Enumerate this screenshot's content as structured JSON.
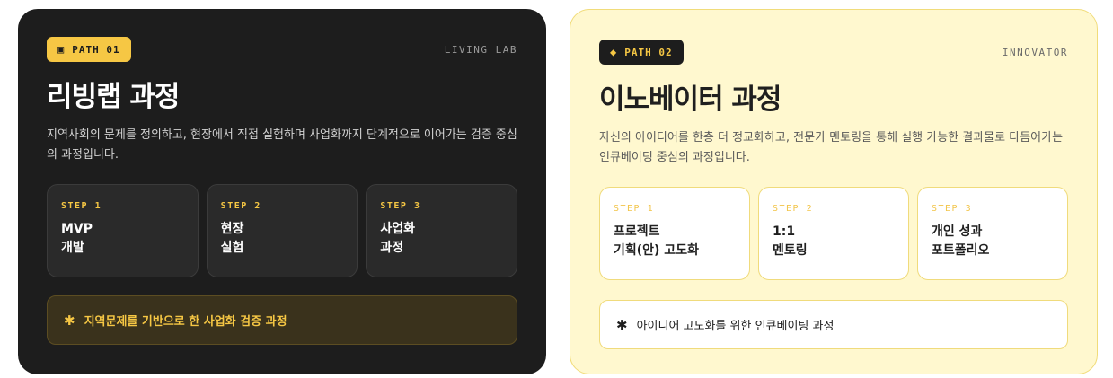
{
  "cards": [
    {
      "badge": {
        "icon": "box-icon",
        "glyph": "▣",
        "label": "PATH 01"
      },
      "eyebrow": "LIVING LAB",
      "title": "리빙랩 과정",
      "description": "지역사회의 문제를 정의하고, 현장에서 직접 실험하며 사업화까지 단계적으로 이어가는 검증 중심의 과정입니다.",
      "steps": [
        {
          "label": "STEP 1",
          "line1": "MVP",
          "line2": "개발"
        },
        {
          "label": "STEP 2",
          "line1": "현장",
          "line2": "실험"
        },
        {
          "label": "STEP 3",
          "line1": "사업화",
          "line2": "과정"
        }
      ],
      "note": {
        "icon": "asterisk-icon",
        "glyph": "✱",
        "text": "지역문제를 기반으로 한 사업화 검증 과정"
      }
    },
    {
      "badge": {
        "icon": "diamond-icon",
        "glyph": "◆",
        "label": "PATH 02"
      },
      "eyebrow": "INNOVATOR",
      "title": "이노베이터 과정",
      "description": "자신의 아이디어를 한층 더 정교화하고, 전문가 멘토링을 통해 실행 가능한 결과물로 다듬어가는 인큐베이팅 중심의 과정입니다.",
      "steps": [
        {
          "label": "STEP 1",
          "line1": "프로젝트",
          "line2": "기획(안) 고도화"
        },
        {
          "label": "STEP 2",
          "line1": "1:1",
          "line2": "멘토링"
        },
        {
          "label": "STEP 3",
          "line1": "개인 성과",
          "line2": "포트폴리오"
        }
      ],
      "note": {
        "icon": "asterisk-icon",
        "glyph": "✱",
        "text": "아이디어 고도화를 위한 인큐베이팅 과정"
      }
    }
  ],
  "colors": {
    "accent": "#f6c744",
    "dark_bg": "#1d1d1d",
    "light_bg": "#fff8cf"
  }
}
